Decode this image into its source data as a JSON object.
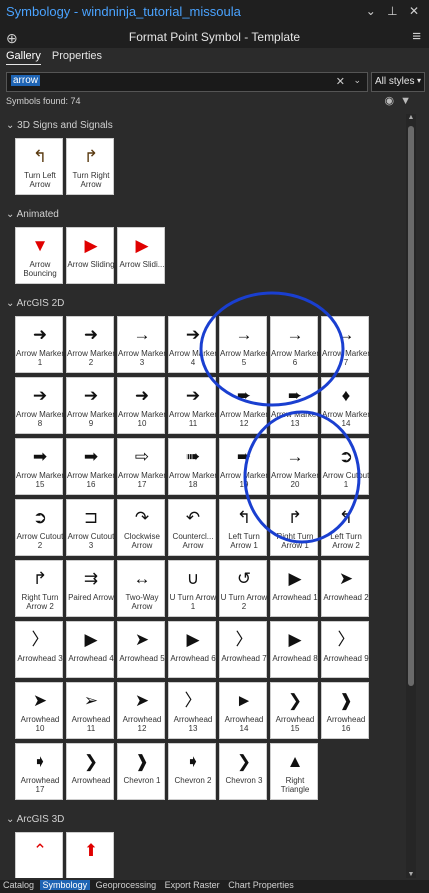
{
  "window": {
    "title": "Symbology - windninja_tutorial_missoula",
    "subtitle": "Format Point Symbol - Template",
    "controls": "⌄ ⊥ ✕"
  },
  "tabs": [
    "Gallery",
    "Properties"
  ],
  "search": {
    "value": "arrow",
    "styles_label": "All styles"
  },
  "symbols_found": "Symbols found: 74",
  "groups": [
    {
      "name": "3D Signs and Signals",
      "items": [
        {
          "label": "Turn Left Arrow",
          "icon": "↰",
          "color": "#5a3a10"
        },
        {
          "label": "Turn Right Arrow",
          "icon": "↱",
          "color": "#5a3a10"
        }
      ]
    },
    {
      "name": "Animated",
      "items": [
        {
          "label": "Arrow Bouncing",
          "icon": "▼",
          "color": "#e00000"
        },
        {
          "label": "Arrow Sliding",
          "icon": "▶",
          "color": "#e00000"
        },
        {
          "label": "Arrow Slidi...",
          "icon": "▶",
          "color": "#e00000"
        }
      ]
    },
    {
      "name": "ArcGIS 2D",
      "items": [
        {
          "label": "Arrow Marker 1",
          "icon": "➜"
        },
        {
          "label": "Arrow Marker 2",
          "icon": "➜"
        },
        {
          "label": "Arrow Marker 3",
          "icon": "→"
        },
        {
          "label": "Arrow Marker 4",
          "icon": "➔"
        },
        {
          "label": "Arrow Marker 5",
          "icon": "→"
        },
        {
          "label": "Arrow Marker 6",
          "icon": "→"
        },
        {
          "label": "Arrow Marker 7",
          "icon": "→"
        },
        {
          "label": "Arrow Marker 8",
          "icon": "➔"
        },
        {
          "label": "Arrow Marker 9",
          "icon": "➔"
        },
        {
          "label": "Arrow Marker 10",
          "icon": "➜"
        },
        {
          "label": "Arrow Marker 11",
          "icon": "➔"
        },
        {
          "label": "Arrow Marker 12",
          "icon": "➨"
        },
        {
          "label": "Arrow Marker 13",
          "icon": "➨"
        },
        {
          "label": "Arrow Marker 14",
          "icon": "♦"
        },
        {
          "label": "Arrow Marker 15",
          "icon": "➡"
        },
        {
          "label": "Arrow Marker 16",
          "icon": "➡"
        },
        {
          "label": "Arrow Marker 17",
          "icon": "⇨"
        },
        {
          "label": "Arrow Marker 18",
          "icon": "➠"
        },
        {
          "label": "Arrow Marker 19",
          "icon": "➨"
        },
        {
          "label": "Arrow Marker 20",
          "icon": "→"
        },
        {
          "label": "Arrow Cutout 1",
          "icon": "➲"
        },
        {
          "label": "Arrow Cutout 2",
          "icon": "➲"
        },
        {
          "label": "Arrow Cutout 3",
          "icon": "⊐"
        },
        {
          "label": "Clockwise Arrow",
          "icon": "↷"
        },
        {
          "label": "Countercl... Arrow",
          "icon": "↶"
        },
        {
          "label": "Left Turn Arrow 1",
          "icon": "↰"
        },
        {
          "label": "Right Turn Arrow 1",
          "icon": "↱"
        },
        {
          "label": "Left Turn Arrow 2",
          "icon": "↰"
        },
        {
          "label": "Right Turn Arrow 2",
          "icon": "↱"
        },
        {
          "label": "Paired Arrow",
          "icon": "⇉"
        },
        {
          "label": "Two-Way Arrow",
          "icon": "↔"
        },
        {
          "label": "U Turn Arrow 1",
          "icon": "∪"
        },
        {
          "label": "U Turn Arrow 2",
          "icon": "↺"
        },
        {
          "label": "Arrowhead 1",
          "icon": "▶"
        },
        {
          "label": "Arrowhead 2",
          "icon": "➤"
        },
        {
          "label": "Arrowhead 3",
          "icon": "〉"
        },
        {
          "label": "Arrowhead 4",
          "icon": "▶"
        },
        {
          "label": "Arrowhead 5",
          "icon": "➤"
        },
        {
          "label": "Arrowhead 6",
          "icon": "▶"
        },
        {
          "label": "Arrowhead 7",
          "icon": "〉"
        },
        {
          "label": "Arrowhead 8",
          "icon": "▶"
        },
        {
          "label": "Arrowhead 9",
          "icon": "〉"
        },
        {
          "label": "Arrowhead 10",
          "icon": "➤"
        },
        {
          "label": "Arrowhead 11",
          "icon": "➢"
        },
        {
          "label": "Arrowhead 12",
          "icon": "➤"
        },
        {
          "label": "Arrowhead 13",
          "icon": "〉"
        },
        {
          "label": "Arrowhead 14",
          "icon": "►"
        },
        {
          "label": "Arrowhead 15",
          "icon": "❯"
        },
        {
          "label": "Arrowhead 16",
          "icon": "❱"
        },
        {
          "label": "Arrowhead 17",
          "icon": "➧"
        },
        {
          "label": "Arrowhead",
          "icon": "❯"
        },
        {
          "label": "Chevron 1",
          "icon": "❱"
        },
        {
          "label": "Chevron 2",
          "icon": "➧"
        },
        {
          "label": "Chevron 3",
          "icon": "❯"
        },
        {
          "label": "Right Triangle",
          "icon": "▲"
        }
      ]
    },
    {
      "name": "ArcGIS 3D",
      "items": [
        {
          "label": "",
          "icon": "⌃",
          "color": "#e00000"
        },
        {
          "label": "",
          "icon": "⬆",
          "color": "#e00000"
        }
      ]
    }
  ],
  "bottom_tabs": [
    "Catalog",
    "Symbology",
    "Geoprocessing",
    "Export Raster",
    "Chart Properties"
  ],
  "colors": {
    "accent": "#1e64b4",
    "annotation_circle": "#1a3fd0"
  }
}
